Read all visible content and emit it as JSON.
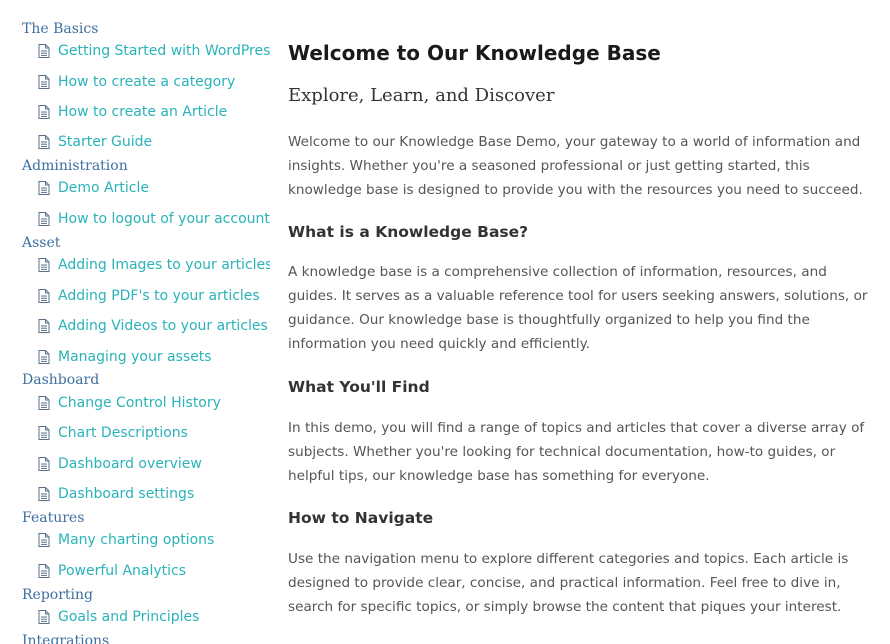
{
  "sidebar": {
    "categories": [
      {
        "label": "The Basics",
        "items": [
          {
            "label": "Getting Started with WordPress"
          },
          {
            "label": "How to create a category"
          },
          {
            "label": "How to create an Article"
          },
          {
            "label": "Starter Guide"
          }
        ]
      },
      {
        "label": "Administration",
        "items": [
          {
            "label": "Demo Article"
          },
          {
            "label": "How to logout of your account"
          }
        ]
      },
      {
        "label": "Asset",
        "items": [
          {
            "label": "Adding Images to your articles"
          },
          {
            "label": "Adding PDF's to your articles"
          },
          {
            "label": "Adding Videos to your articles"
          },
          {
            "label": "Managing your assets"
          }
        ]
      },
      {
        "label": "Dashboard",
        "items": [
          {
            "label": "Change Control History"
          },
          {
            "label": "Chart Descriptions"
          },
          {
            "label": "Dashboard overview"
          },
          {
            "label": "Dashboard settings"
          }
        ]
      },
      {
        "label": "Features",
        "items": [
          {
            "label": "Many charting options"
          },
          {
            "label": "Powerful Analytics"
          }
        ]
      },
      {
        "label": "Reporting",
        "items": [
          {
            "label": "Goals and Principles"
          }
        ]
      },
      {
        "label": "Integrations",
        "items": []
      }
    ],
    "item_icon": "document-icon",
    "link_color": "#2ab3b8",
    "category_color": "#3e6fa0"
  },
  "main": {
    "title": "Welcome to Our Knowledge Base",
    "subtitle": "Explore, Learn, and Discover",
    "intro": "Welcome to our Knowledge Base Demo, your gateway to a world of information and insights. Whether you're a seasoned professional or just getting started, this knowledge base is designed to provide you with the resources you need to succeed.",
    "sections": [
      {
        "heading": "What is a Knowledge Base?",
        "body": "A knowledge base is a comprehensive collection of information, resources, and guides. It serves as a valuable reference tool for users seeking answers, solutions, or guidance. Our knowledge base is thoughtfully organized to help you find the information you need quickly and efficiently."
      },
      {
        "heading": "What You'll Find",
        "body": "In this demo, you will find a range of topics and articles that cover a diverse array of subjects. Whether you're looking for technical documentation, how-to guides, or helpful tips, our knowledge base has something for everyone."
      },
      {
        "heading": "How to Navigate",
        "body": "Use the navigation menu to explore different categories and topics. Each article is designed to provide clear, concise, and practical information. Feel free to dive in, search for specific topics, or simply browse the content that piques your interest."
      }
    ]
  }
}
